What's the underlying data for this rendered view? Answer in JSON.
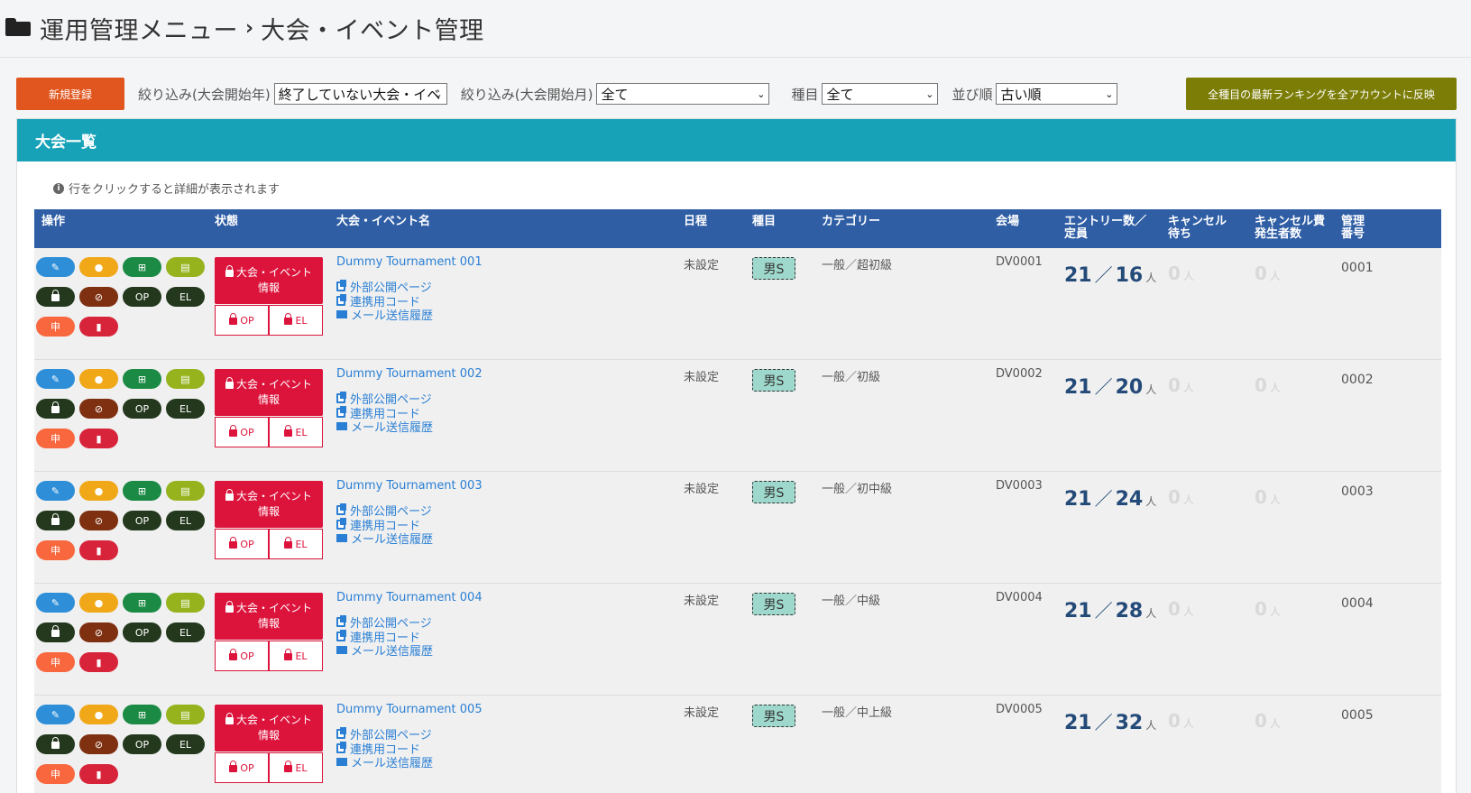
{
  "header": {
    "title_parent": "運用管理メニュー",
    "separator": "›",
    "title": "大会・イベント管理"
  },
  "toolbar": {
    "new_button": "新規登録",
    "filter_year_label": "絞り込み(大会開始年)",
    "filter_year_value": "終了していない大会・イベ",
    "filter_month_label": "絞り込み(大会開始月)",
    "filter_month_value": "全て",
    "event_type_label": "種目",
    "event_type_value": "全て",
    "sort_label": "並び順",
    "sort_value": "古い順",
    "reflect_button": "全種目の最新ランキングを全アカウントに反映"
  },
  "card": {
    "title": "大会一覧",
    "info": "行をクリックすると詳細が表示されます"
  },
  "table": {
    "headers": {
      "ops": "操作",
      "state": "状態",
      "name": "大会・イベント名",
      "date": "日程",
      "type": "種目",
      "category": "カテゴリー",
      "venue": "会場",
      "entry_line1": "エントリー数／",
      "entry_line2": "定員",
      "waiting_line1": "キャンセル",
      "waiting_line2": "待ち",
      "fee_line1": "キャンセル費",
      "fee_line2": "発生者数",
      "mgmt_line1": "管理",
      "mgmt_line2": "番号"
    },
    "op_labels": {
      "op": "OP",
      "el": "EL",
      "apply": "申"
    },
    "state_labels": {
      "main_line1": "大会・イベント",
      "main_line2": "情報",
      "op": "OP",
      "el": "EL"
    },
    "link_labels": {
      "public_page": "外部公開ページ",
      "code": "連携用コード",
      "mail": "メール送信履歴"
    },
    "unit": "人",
    "rows": [
      {
        "name": "Dummy Tournament 001",
        "date": "未設定",
        "type": "男S",
        "category": "一般／超初級",
        "venue": "DV0001",
        "entries": "21",
        "capacity": "16",
        "waiting": "0",
        "fee": "0",
        "number": "0001"
      },
      {
        "name": "Dummy Tournament 002",
        "date": "未設定",
        "type": "男S",
        "category": "一般／初級",
        "venue": "DV0002",
        "entries": "21",
        "capacity": "20",
        "waiting": "0",
        "fee": "0",
        "number": "0002"
      },
      {
        "name": "Dummy Tournament 003",
        "date": "未設定",
        "type": "男S",
        "category": "一般／初中級",
        "venue": "DV0003",
        "entries": "21",
        "capacity": "24",
        "waiting": "0",
        "fee": "0",
        "number": "0003"
      },
      {
        "name": "Dummy Tournament 004",
        "date": "未設定",
        "type": "男S",
        "category": "一般／中級",
        "venue": "DV0004",
        "entries": "21",
        "capacity": "28",
        "waiting": "0",
        "fee": "0",
        "number": "0004"
      },
      {
        "name": "Dummy Tournament 005",
        "date": "未設定",
        "type": "男S",
        "category": "一般／中上級",
        "venue": "DV0005",
        "entries": "21",
        "capacity": "32",
        "waiting": "0",
        "fee": "0",
        "number": "0005"
      }
    ]
  }
}
